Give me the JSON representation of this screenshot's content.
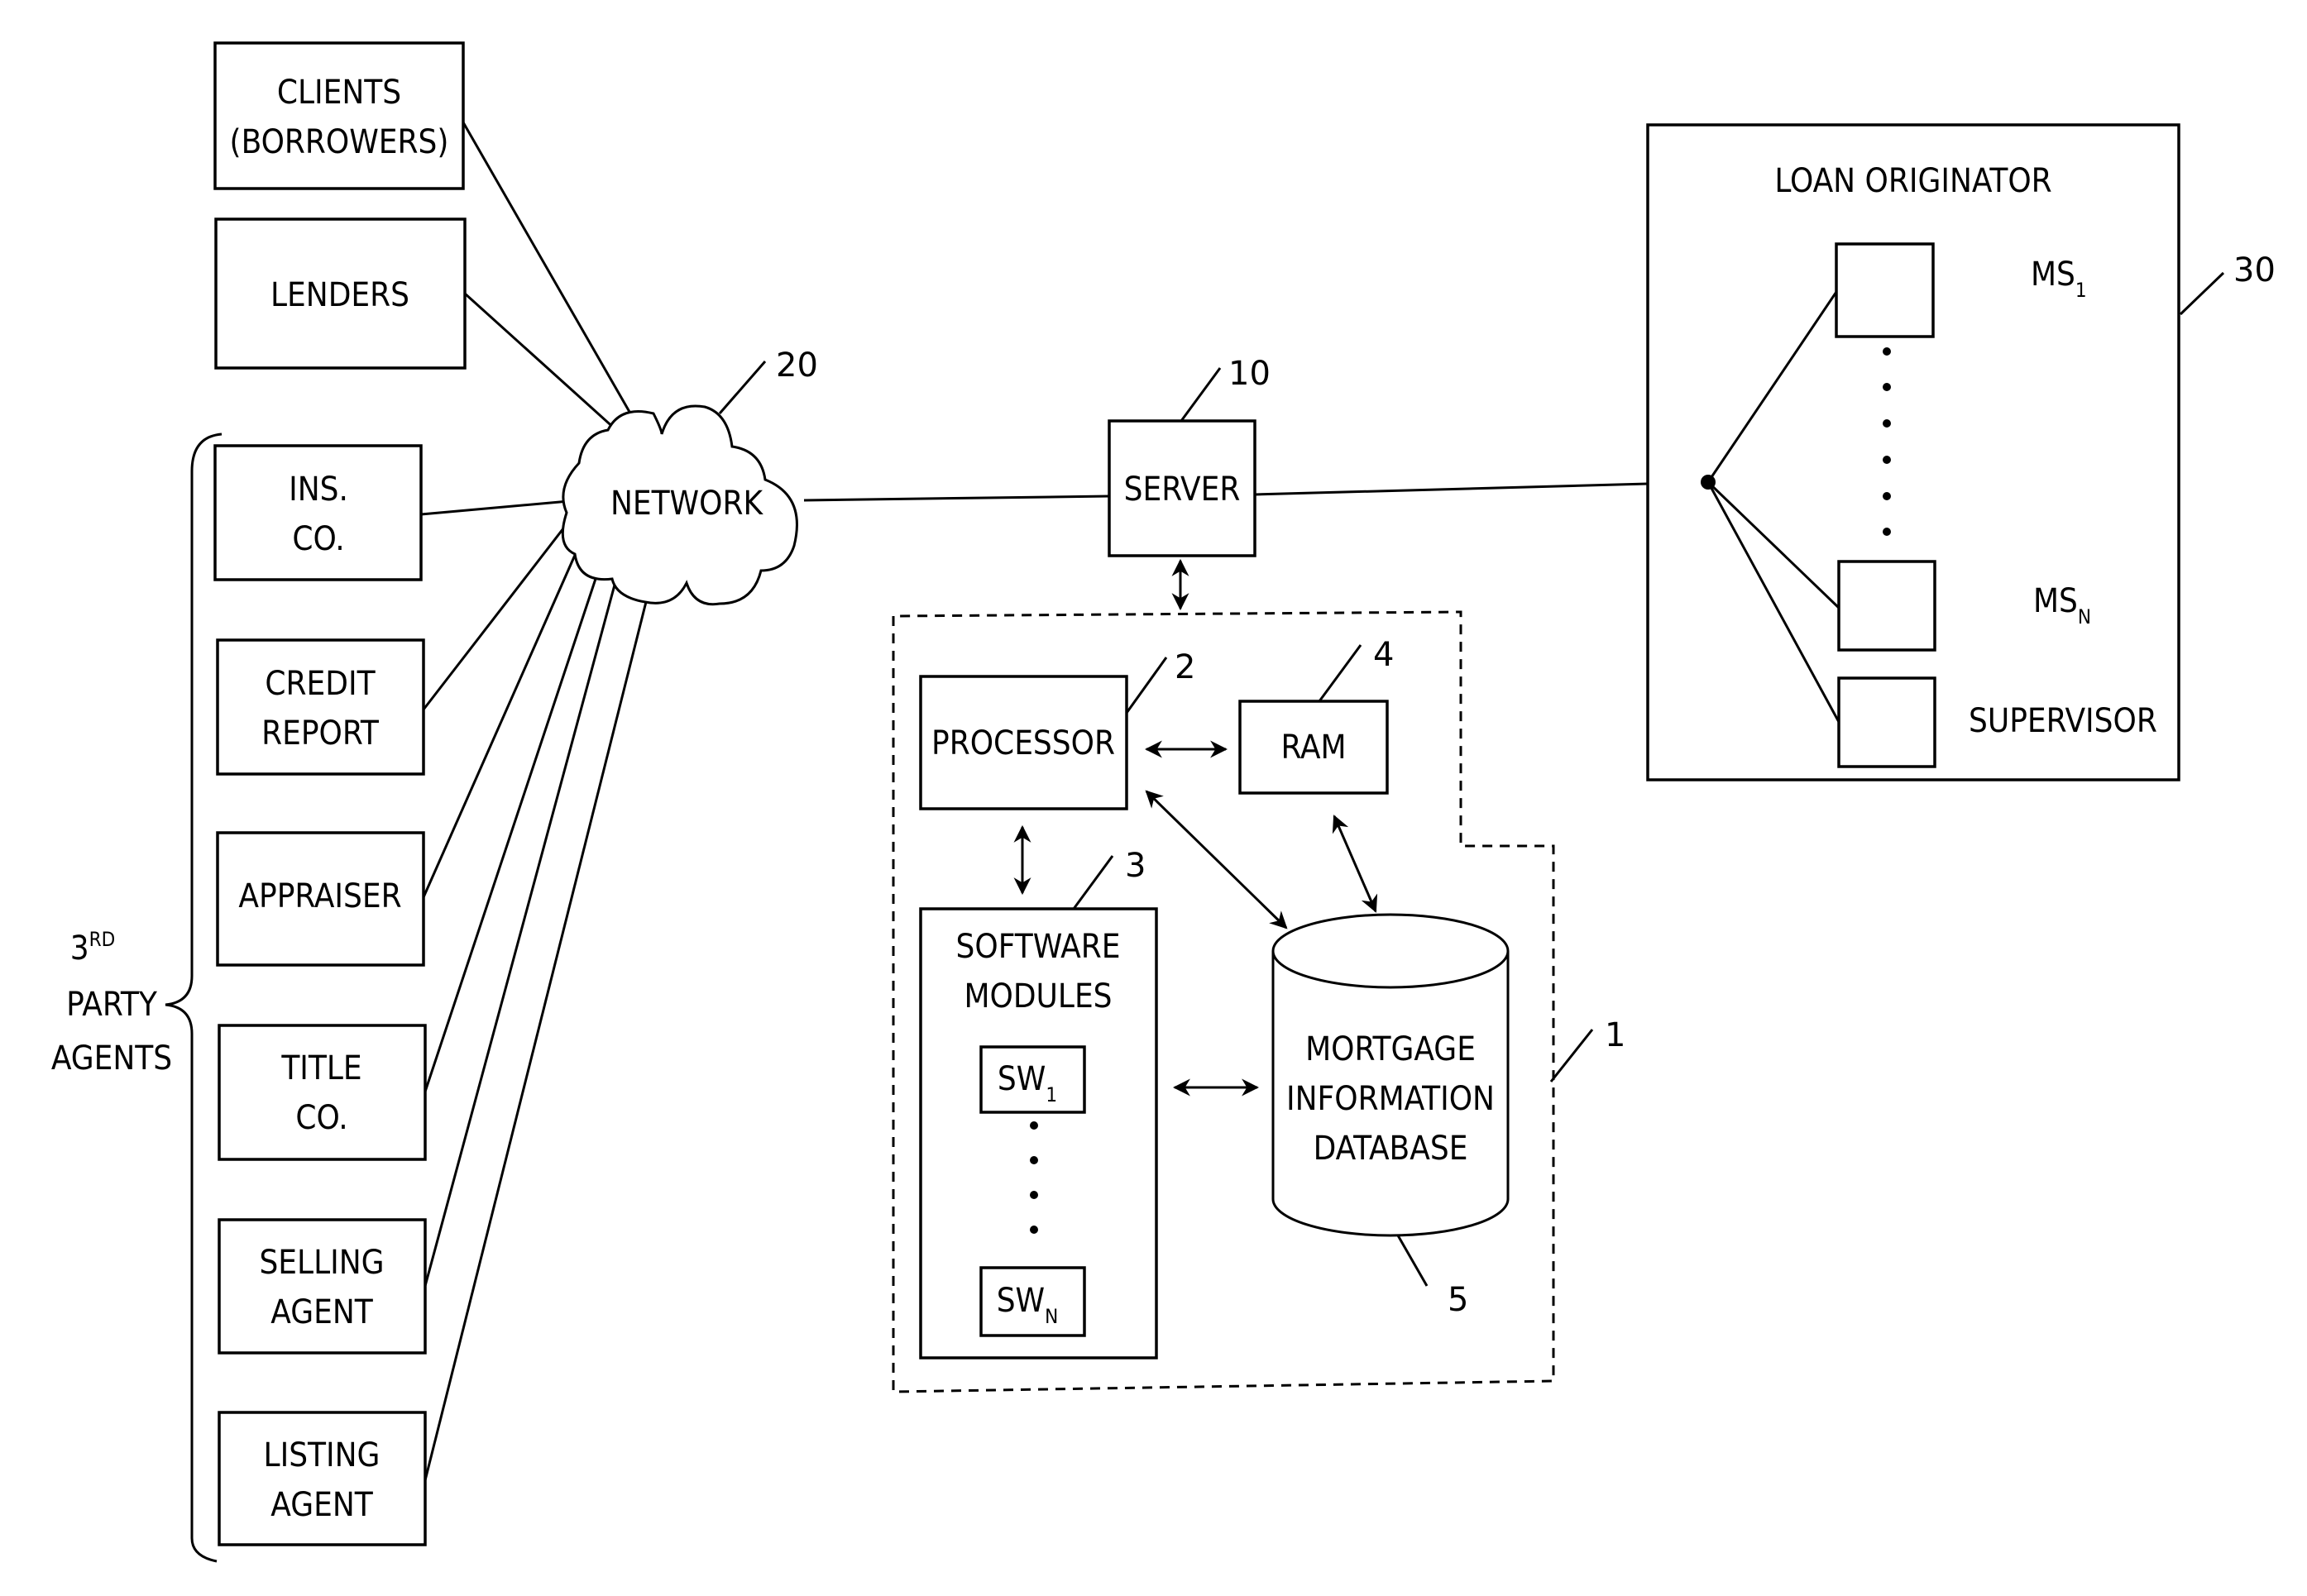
{
  "figure": {
    "external_parties": [
      {
        "id": "clients",
        "lines": [
          "CLIENTS",
          "(BORROWERS)"
        ]
      },
      {
        "id": "lenders",
        "lines": [
          "LENDERS"
        ]
      }
    ],
    "third_party_group": {
      "label_line1": "3",
      "label_sup": "RD",
      "label_line2": "PARTY",
      "label_line3": "AGENTS",
      "agents": [
        {
          "id": "ins-co",
          "lines": [
            "INS.",
            "CO."
          ]
        },
        {
          "id": "credit-report",
          "lines": [
            "CREDIT",
            "REPORT"
          ]
        },
        {
          "id": "appraiser",
          "lines": [
            "APPRAISER"
          ]
        },
        {
          "id": "title-co",
          "lines": [
            "TITLE",
            "CO."
          ]
        },
        {
          "id": "selling-agent",
          "lines": [
            "SELLING",
            "AGENT"
          ]
        },
        {
          "id": "listing-agent",
          "lines": [
            "LISTING",
            "AGENT"
          ]
        }
      ]
    },
    "network": {
      "label": "NETWORK",
      "ref": "20"
    },
    "server": {
      "label": "SERVER",
      "ref": "10"
    },
    "computer_system": {
      "ref": "1",
      "processor": {
        "label": "PROCESSOR",
        "ref": "2"
      },
      "ram": {
        "label": "RAM",
        "ref": "4"
      },
      "software": {
        "lines": [
          "SOFTWARE",
          "MODULES"
        ],
        "ref": "3",
        "first_module": "SW",
        "first_sub": "1",
        "last_module": "SW",
        "last_sub": "N"
      },
      "database": {
        "lines": [
          "MORTGAGE",
          "INFORMATION",
          "DATABASE"
        ],
        "ref": "5"
      }
    },
    "loan_originator": {
      "title": "LOAN ORIGINATOR",
      "ref": "30",
      "stations": [
        {
          "label": "MS",
          "sub": "1"
        },
        {
          "label": "MS",
          "sub": "N"
        },
        {
          "label": "SUPERVISOR",
          "sub": ""
        }
      ]
    }
  }
}
